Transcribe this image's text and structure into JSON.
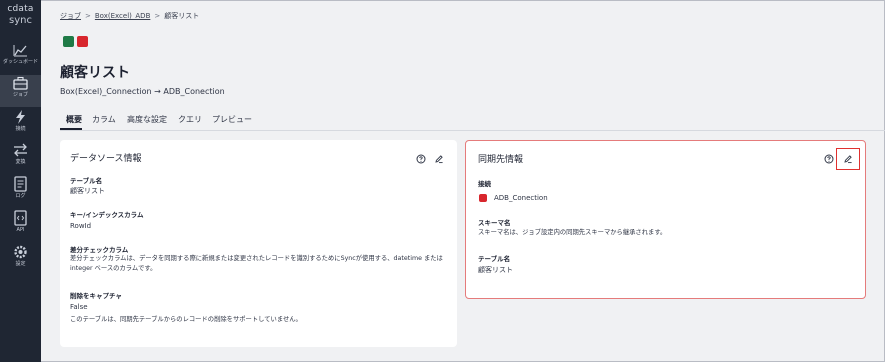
{
  "sidebar": {
    "logo_brand": "cdata",
    "logo_sub": "sync",
    "items": [
      {
        "label": "ダッシュボード",
        "icon": "chart-icon"
      },
      {
        "label": "ジョブ",
        "icon": "briefcase-icon"
      },
      {
        "label": "接続",
        "icon": "bolt-icon"
      },
      {
        "label": "変換",
        "icon": "transform-icon"
      },
      {
        "label": "ログ",
        "icon": "log-icon"
      },
      {
        "label": "API",
        "icon": "api-icon"
      },
      {
        "label": "設定",
        "icon": "gear-icon"
      }
    ]
  },
  "breadcrumb": {
    "items": [
      "ジョブ",
      "Box(Excel)_ADB",
      "顧客リスト"
    ],
    "separator": ">"
  },
  "header": {
    "title": "顧客リスト",
    "subtitle": "Box(Excel)_Connection → ADB_Conection"
  },
  "tabs": [
    "概要",
    "カラム",
    "高度な設定",
    "クエリ",
    "プレビュー"
  ],
  "source_panel": {
    "title": "データソース情報",
    "table_label": "テーブル名",
    "table_value": "顧客リスト",
    "key_label": "キー/インデックスカラム",
    "key_value": "RowId",
    "diff_label": "差分チェックカラム",
    "diff_desc": "差分チェックカラムは、データを同期する際に新規または変更されたレコードを識別するためにSyncが使用する、datetime または integer ベースのカラムです。",
    "delete_label": "削除をキャプチャ",
    "delete_value": "False",
    "delete_desc": "このテーブルは、同期先テーブルからのレコードの削除をサポートしていません。"
  },
  "dest_panel": {
    "title": "同期先情報",
    "conn_label": "接続",
    "conn_value": "ADB_Conection",
    "schema_label": "スキーマ名",
    "schema_desc": "スキーマ名は、ジョブ設定内の同期先スキーマから継承されます。",
    "table_label": "テーブル名",
    "table_value": "顧客リスト"
  },
  "colors": {
    "sidebar": "#1f2633",
    "accent_red": "#e0312f",
    "excel_green": "#1f7a46"
  }
}
